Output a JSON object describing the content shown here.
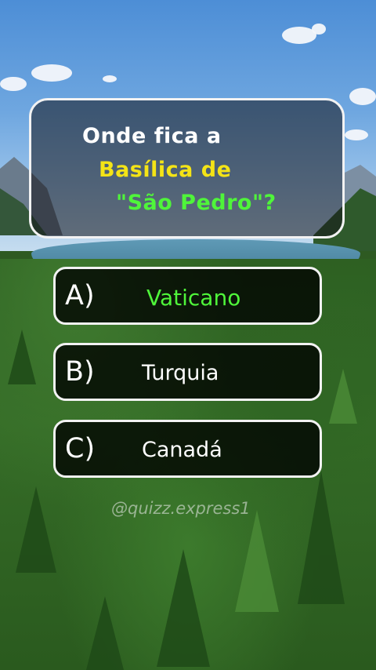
{
  "question": {
    "line1": "Onde fica a",
    "line2": "Basílica de",
    "line3": "\"São Pedro\"?"
  },
  "options": [
    {
      "letter": "A)",
      "text": "Vaticano",
      "highlight": true
    },
    {
      "letter": "B)",
      "text": "Turquia",
      "highlight": false
    },
    {
      "letter": "C)",
      "text": "Canadá",
      "highlight": false
    }
  ],
  "watermark": "@quizz.express1",
  "colors": {
    "highlight_yellow": "#f4e416",
    "highlight_green": "#4ff53a",
    "text_white": "#ffffff",
    "card_border": "#f2f2f2"
  }
}
